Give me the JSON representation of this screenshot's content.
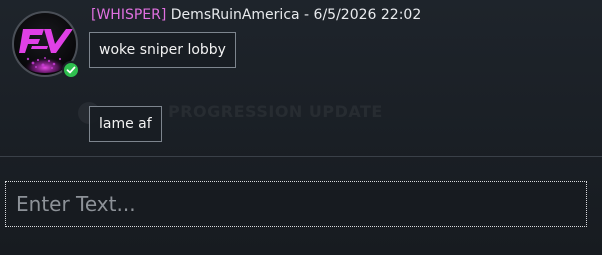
{
  "background_text": {
    "top_right": "",
    "line_one": "",
    "heading": "PROGRESSION UPDATE",
    "heading_right": "",
    "line_two": ""
  },
  "message": {
    "tag": "[WHISPER]",
    "sender": "DemsRuinAmerica",
    "separator": " - ",
    "timestamp": "6/5/2026 22:02",
    "lines": [
      "woke sniper lobby",
      "lame af"
    ]
  },
  "avatar": {
    "icon": "fv-logo-avatar",
    "status": "online",
    "status_icon": "check-icon"
  },
  "composer": {
    "placeholder": "Enter Text...",
    "value": ""
  },
  "colors": {
    "whisper_tag": "#e070e0",
    "status_online": "#2fbf4f",
    "logo_accent": "#d43fd4"
  }
}
